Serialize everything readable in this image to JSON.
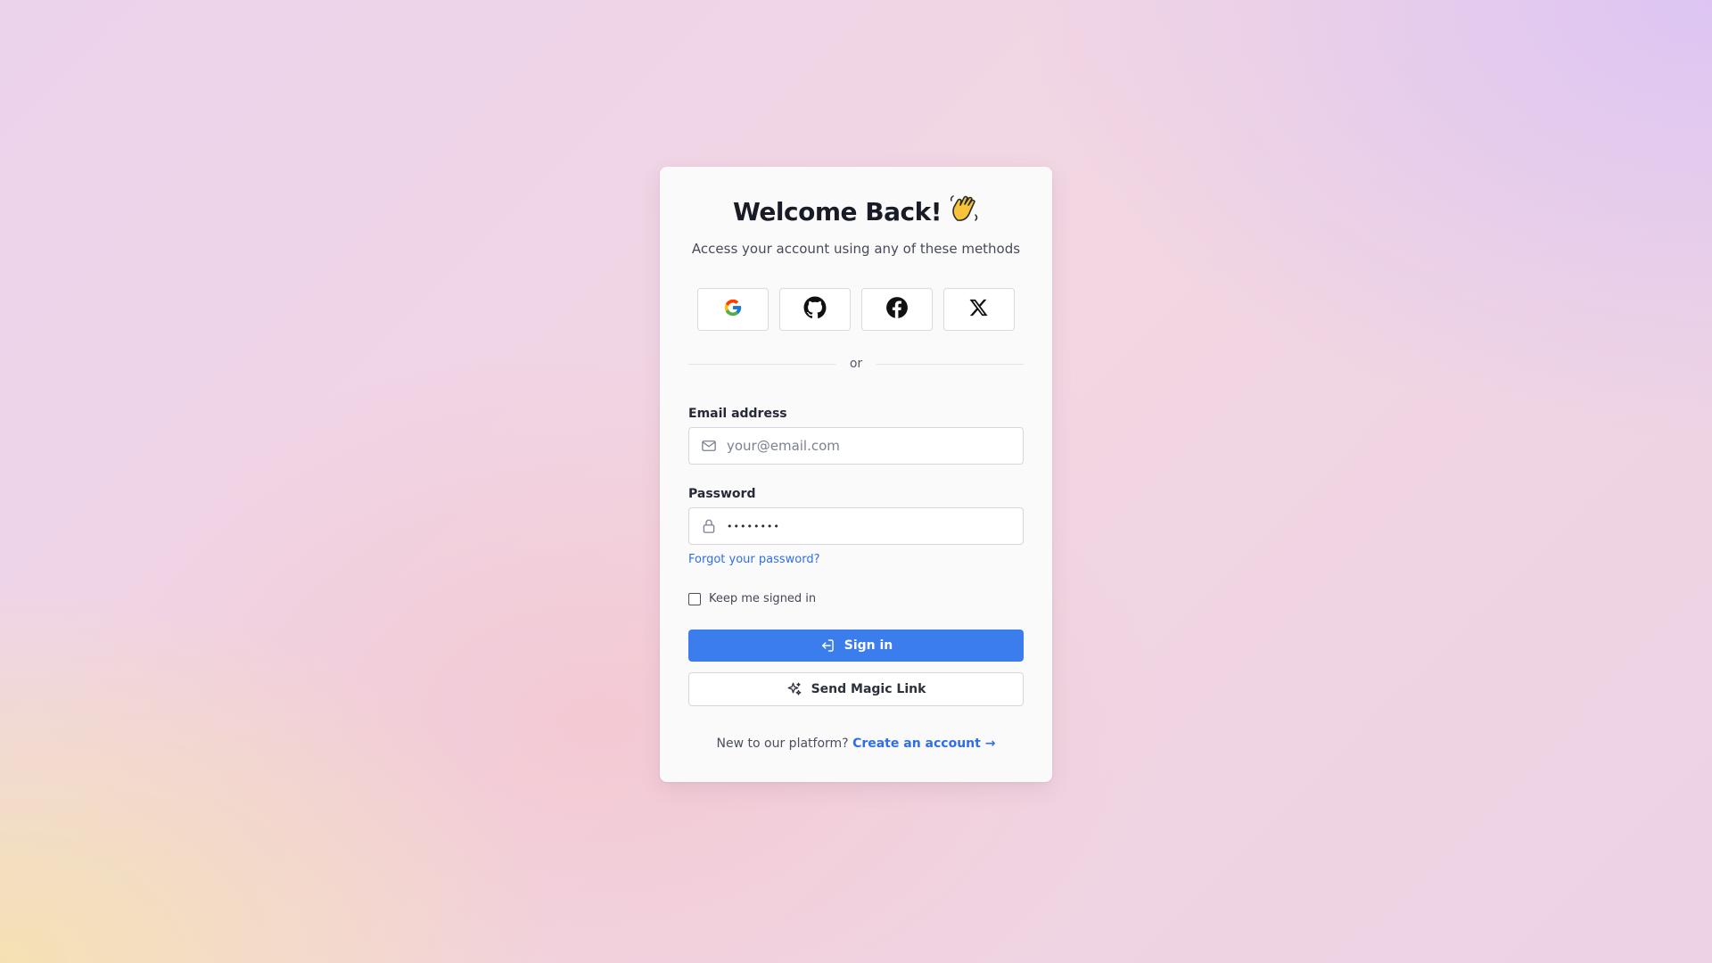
{
  "card": {
    "title": "Welcome Back!",
    "title_emoji_icon": "waving-hand-icon",
    "subtitle": "Access your account using any of these methods"
  },
  "social": [
    {
      "provider": "Google",
      "icon": "google-icon"
    },
    {
      "provider": "GitHub",
      "icon": "github-icon"
    },
    {
      "provider": "Facebook",
      "icon": "facebook-icon"
    },
    {
      "provider": "X",
      "icon": "x-icon"
    }
  ],
  "divider": {
    "text": "or"
  },
  "email": {
    "label": "Email address",
    "placeholder": "your@email.com",
    "value": "",
    "icon": "mail-icon"
  },
  "password": {
    "label": "Password",
    "value": "••••••••",
    "icon": "lock-icon"
  },
  "forgot_link": "Forgot your password?",
  "remember": {
    "label": "Keep me signed in",
    "checked": false
  },
  "sign_in": {
    "label": "Sign in",
    "icon": "sign-in-icon"
  },
  "magic_link": {
    "label": "Send Magic Link",
    "icon": "sparkles-icon"
  },
  "footer": {
    "prompt": "New to our platform?",
    "link": "Create an account →"
  },
  "colors": {
    "primary": "#3b7ded",
    "link": "#2f6fe4",
    "card_bg": "#fbfafb"
  }
}
